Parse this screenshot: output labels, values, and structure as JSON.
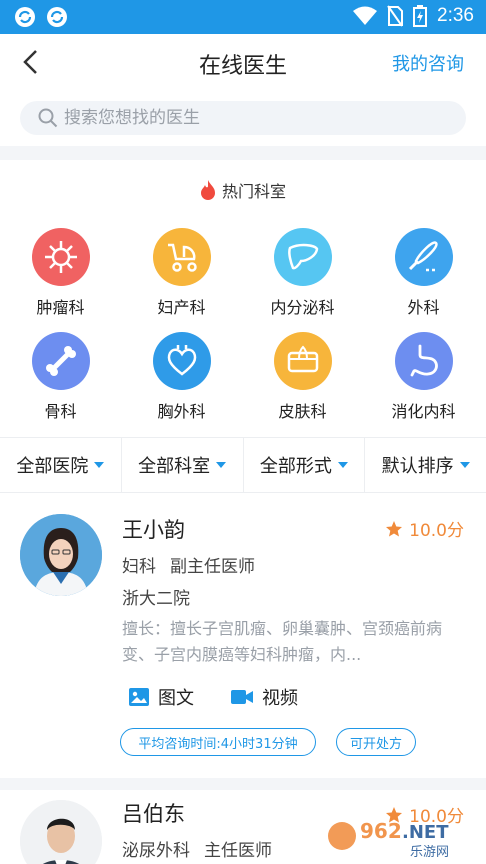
{
  "status_bar": {
    "time": "2:36"
  },
  "nav": {
    "title": "在线医生",
    "right_link": "我的咨询"
  },
  "search": {
    "placeholder": "搜索您想找的医生"
  },
  "hot": {
    "title": "热门科室"
  },
  "departments": [
    {
      "label": "肿瘤科",
      "color": "#f06262",
      "icon": "virus-icon"
    },
    {
      "label": "妇产科",
      "color": "#f7b53b",
      "icon": "stroller-icon"
    },
    {
      "label": "内分泌科",
      "color": "#56c6f2",
      "icon": "liver-icon"
    },
    {
      "label": "外科",
      "color": "#3ea4ee",
      "icon": "scalpel-icon"
    },
    {
      "label": "骨科",
      "color": "#6d8ef0",
      "icon": "bone-icon"
    },
    {
      "label": "胸外科",
      "color": "#2f9be8",
      "icon": "heart-icon"
    },
    {
      "label": "皮肤科",
      "color": "#f7b53b",
      "icon": "skin-icon"
    },
    {
      "label": "消化内科",
      "color": "#6d8ef0",
      "icon": "stomach-icon"
    }
  ],
  "filters": [
    "全部医院",
    "全部科室",
    "全部形式",
    "默认排序"
  ],
  "doctors": [
    {
      "name": "王小韵",
      "score": "10.0分",
      "dept": "妇科",
      "title": "副主任医师",
      "hospital": "浙大二院",
      "desc": "擅长：擅长子宫肌瘤、卵巢囊肿、宫颈癌前病变、子宫内膜癌等妇科肿瘤，内...",
      "services": [
        "图文",
        "视频"
      ],
      "tags": [
        "平均咨询时间:4小时31分钟",
        "可开处方"
      ]
    },
    {
      "name": "吕伯东",
      "score": "10.0分",
      "dept": "泌尿外科",
      "title": "主任医师"
    }
  ],
  "watermark": {
    "text": "962.NET",
    "subtext": "乐游网"
  },
  "colors": {
    "accent": "#1f97e6",
    "score": "#f08a3a",
    "fire": "#f04a3e"
  }
}
